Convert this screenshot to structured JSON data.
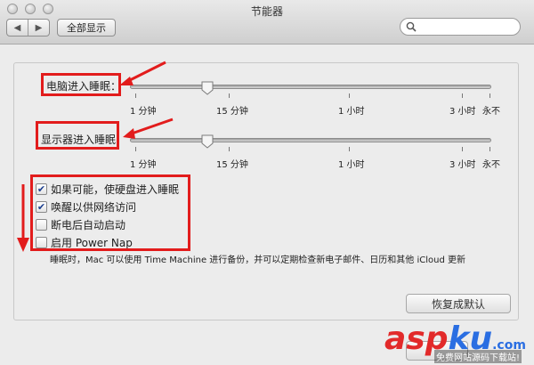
{
  "window": {
    "title": "节能器"
  },
  "toolbar": {
    "back_icon": "◀",
    "forward_icon": "▶",
    "show_all_label": "全部显示",
    "search_placeholder": ""
  },
  "sleep": {
    "computer_label": "电脑进入睡眠：",
    "display_label": "显示器进入睡眠：",
    "ticks": [
      "1 分钟",
      "15 分钟",
      "1 小时",
      "3 小时",
      "永不"
    ],
    "computer_value": "15 分钟",
    "display_value": "15 分钟"
  },
  "options": [
    {
      "label": "如果可能，使硬盘进入睡眠",
      "checked": true
    },
    {
      "label": "唤醒以供网络访问",
      "checked": true
    },
    {
      "label": "断电后自动启动",
      "checked": false
    },
    {
      "label": "启用 Power Nap",
      "checked": false
    }
  ],
  "note": "睡眠时，Mac 可以使用 Time Machine 进行备份，并可以定期检查新电子邮件、日历和其他 iCloud 更新",
  "restore_label": "恢复成默认",
  "watermark": {
    "brand": "aspku",
    "brand_a": "asp",
    "brand_b": "ku",
    "suffix": ".com",
    "subtitle": "免费网站源码下载站!"
  },
  "colors": {
    "annotation_red": "#e21c1c",
    "check_blue": "#1b3f8f"
  }
}
